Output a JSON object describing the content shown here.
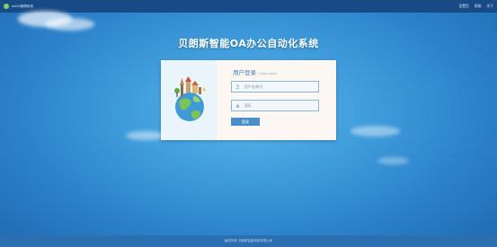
{
  "header": {
    "app_name": "oaOA管理系统",
    "nav": [
      "设置页",
      "帮助",
      "关于"
    ]
  },
  "main": {
    "title": "贝朗斯智能OA办公自动化系统"
  },
  "login": {
    "title": "用户登录",
    "subtitle": "/ User Login",
    "username_placeholder": "用户名/帐号",
    "password_placeholder": "密码",
    "submit_label": "登录"
  },
  "footer": {
    "text": "版权所有  贝朗斯智能科技有限公司"
  },
  "icons": [
    "user-icon",
    "lock-icon",
    "globe-landmarks-icon",
    "brand-logo-icon"
  ],
  "colors": {
    "top_bar": "#184a86",
    "accent_button": "#4a8fcb",
    "title_text": "#4a7fb0"
  }
}
